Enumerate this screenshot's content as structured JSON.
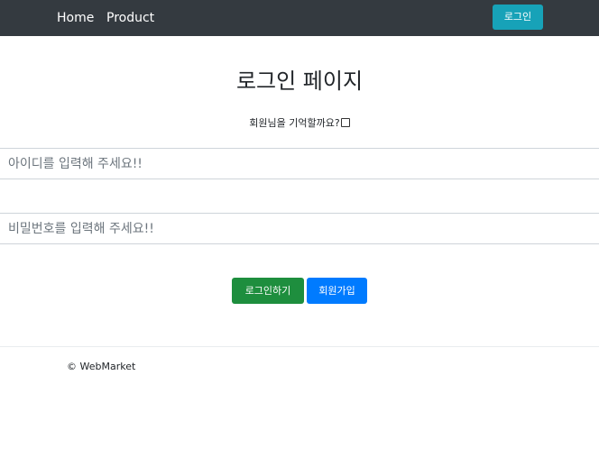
{
  "nav": {
    "home": "Home",
    "product": "Product",
    "login_button": "로그인"
  },
  "main": {
    "title": "로그인 페이지",
    "remember_label": "회원님을 기억할까요?",
    "remember_checked": false,
    "id_placeholder": "아이디를 입력해 주세요!!",
    "password_placeholder": "비밀번호를 입력해 주세요!!",
    "login_button": "로그인하기",
    "join_button": "회원가입"
  },
  "footer": {
    "copyright": "© WebMarket"
  },
  "colors": {
    "navbar": "#343a40",
    "nav_login_button": "#17a2b8",
    "login_button": "#1e8e3e",
    "join_button": "#007bff"
  }
}
